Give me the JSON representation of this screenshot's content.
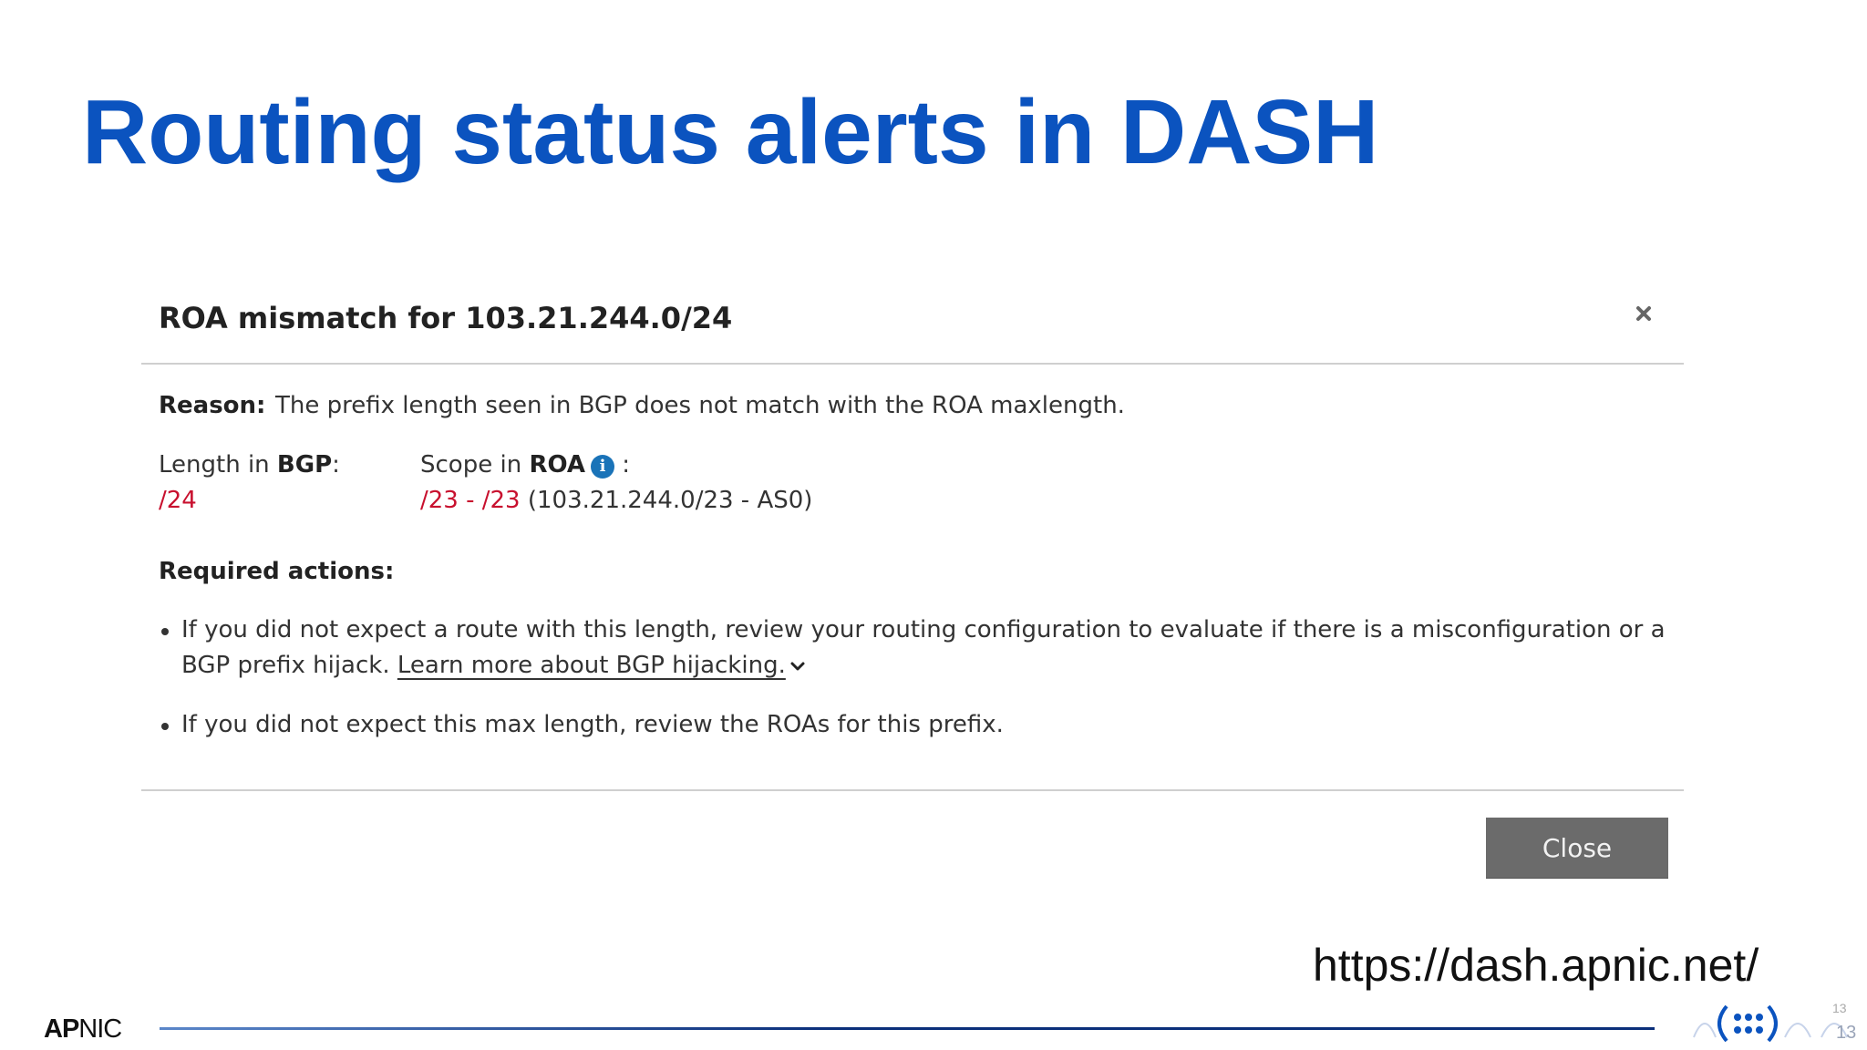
{
  "slide": {
    "title": "Routing status alerts in DASH",
    "url": "https://dash.apnic.net/",
    "footer_logo_bold": "AP",
    "footer_logo_rest": "NIC",
    "page_number_top": "13",
    "page_number": "13"
  },
  "dialog": {
    "title": "ROA mismatch for 103.21.244.0/24",
    "close_icon": "close-x-icon",
    "reason_label": "Reason:",
    "reason_text": "The prefix length seen in BGP does not match with the ROA maxlength.",
    "length_label_prefix": "Length in ",
    "length_label_bold": "BGP",
    "length_label_suffix": ":",
    "length_value": "/24",
    "scope_label_prefix": "Scope in ",
    "scope_label_bold": "ROA",
    "scope_label_suffix": " :",
    "scope_info_icon": "info-icon",
    "scope_value_red": "/23 - /23",
    "scope_value_rest": " (103.21.244.0/23 - AS0)",
    "actions_label": "Required actions:",
    "action1_line1": "If you did not expect a route with this length, review your routing configuration to evaluate if there is a misconfiguration or a",
    "action1_line2_prefix": "BGP prefix hijack. ",
    "action1_link": "Learn more about BGP hijacking.",
    "action2": "If you did not expect this max length, review the ROAs for this prefix.",
    "close_button_label": "Close"
  },
  "colors": {
    "title_blue": "#0B53BF",
    "alert_red": "#C8102E",
    "button_gray": "#6b6b6b",
    "info_blue": "#1A73B8",
    "footer_line_navy": "#0B2F7A"
  }
}
